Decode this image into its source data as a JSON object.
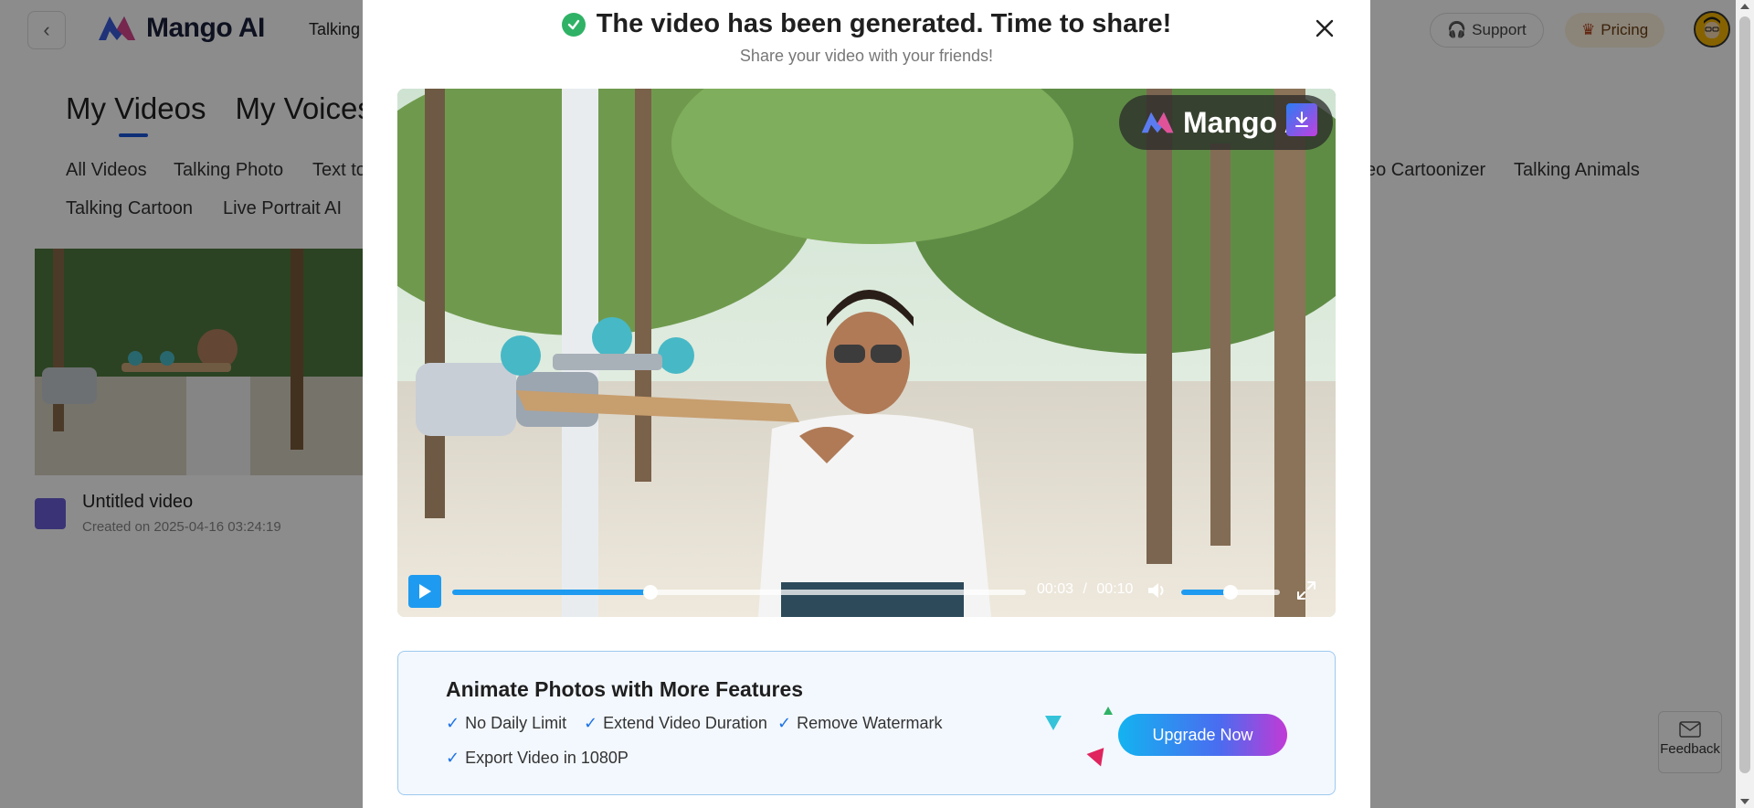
{
  "app": {
    "brand": "Mango AI",
    "nav_partial": "Talking",
    "support_label": "Support",
    "pricing_label": "Pricing"
  },
  "page": {
    "main_tabs": [
      "My Videos",
      "My Voices"
    ],
    "filters": [
      "All Videos",
      "Talking Photo",
      "Text to",
      "eo Cartoonizer",
      "Talking Animals",
      "Talking Cartoon",
      "Live Portrait AI"
    ],
    "card": {
      "title": "Untitled video",
      "created": "Created on 2025-04-16 03:24:19"
    },
    "feedback_label": "Feedback"
  },
  "modal": {
    "title": "The video has been generated. Time to share!",
    "subtitle": "Share your video with your friends!",
    "video": {
      "watermark": "Mango A",
      "current_time": "00:03",
      "separator": "/",
      "duration": "00:10",
      "progress": 0.345,
      "volume": 0.5
    },
    "promo": {
      "title": "Animate Photos with More Features",
      "features": [
        "No Daily Limit",
        "Extend Video Duration",
        "Remove Watermark",
        "Export Video in 1080P"
      ],
      "tick": "✓",
      "cta": "Upgrade Now"
    }
  },
  "colors": {
    "accent": "#1e9bf0",
    "success": "#2fb265",
    "brand_dark": "#1b1f3b"
  }
}
